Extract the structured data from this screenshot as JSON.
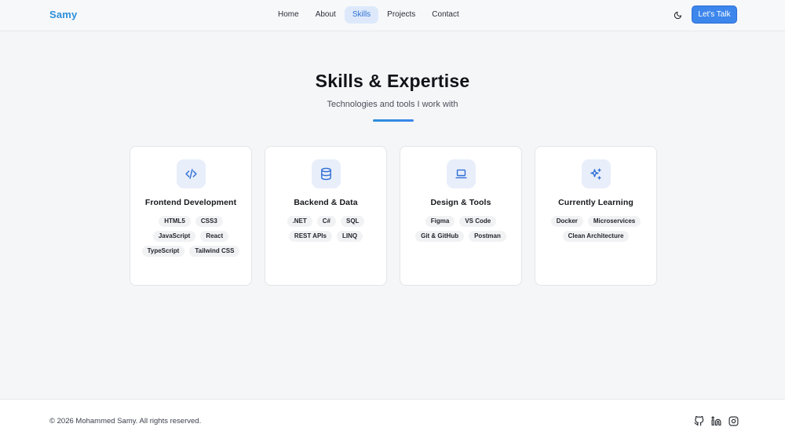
{
  "header": {
    "logo": "Samy",
    "nav": [
      {
        "label": "Home",
        "active": false
      },
      {
        "label": "About",
        "active": false
      },
      {
        "label": "Skills",
        "active": true
      },
      {
        "label": "Projects",
        "active": false
      },
      {
        "label": "Contact",
        "active": false
      }
    ],
    "theme_icon": "moon-icon",
    "cta_label": "Let's Talk"
  },
  "main": {
    "title": "Skills & Expertise",
    "subtitle": "Technologies and tools I work with",
    "cards": [
      {
        "icon": "code-icon",
        "title": "Frontend Development",
        "tags": [
          "HTML5",
          "CSS3",
          "JavaScript",
          "React",
          "TypeScript",
          "Tailwind CSS"
        ]
      },
      {
        "icon": "database-icon",
        "title": "Backend & Data",
        "tags": [
          ".NET",
          "C#",
          "SQL",
          "REST APIs",
          "LINQ"
        ]
      },
      {
        "icon": "laptop-icon",
        "title": "Design & Tools",
        "tags": [
          "Figma",
          "VS Code",
          "Git & GitHub",
          "Postman"
        ]
      },
      {
        "icon": "sparkles-icon",
        "title": "Currently Learning",
        "tags": [
          "Docker",
          "Microservices",
          "Clean Architecture"
        ]
      }
    ]
  },
  "footer": {
    "copyright": "© 2026 Mohammed Samy. All rights reserved.",
    "socials": [
      "github-icon",
      "linkedin-icon",
      "instagram-icon"
    ]
  },
  "colors": {
    "accent": "#3c86ec",
    "logo": "#2b8fd9",
    "nav_active_bg": "#dde9fb",
    "icon_bg": "#e8eefa"
  }
}
